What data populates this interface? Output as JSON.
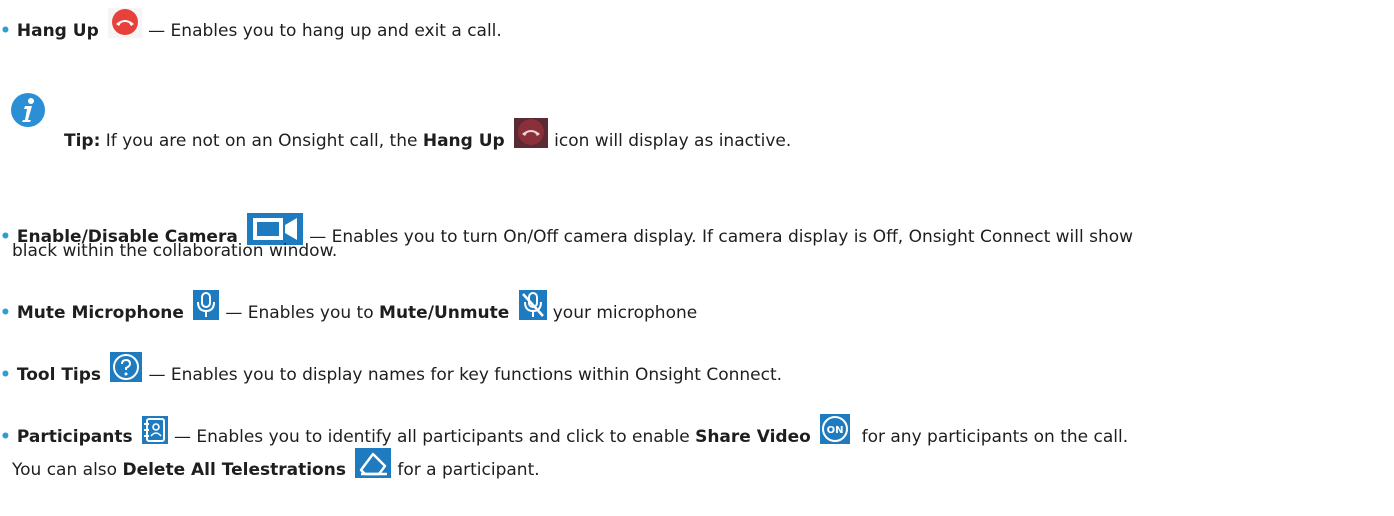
{
  "items": {
    "hangup": {
      "bullet": "•",
      "term": "Hang Up",
      "icon": "hang-up-icon",
      "desc": "— Enables you to hang up and exit a call."
    },
    "tip": {
      "icon": "info-icon",
      "label": "Tip:",
      "text1": "If you are not on an Onsight call, the",
      "term": "Hang Up",
      "text2": "icon will display as inactive."
    },
    "camera": {
      "bullet": "•",
      "term": "Enable/Disable Camera",
      "icon": "camera-icon",
      "desc": "— Enables you to turn On/Off camera display. If camera display is Off, Onsight Connect will show",
      "desc_cont": "black within the collaboration window."
    },
    "mute": {
      "bullet": "•",
      "term": "Mute Microphone",
      "icon": "microphone-icon",
      "desc1": "— Enables you to",
      "term2": "Mute",
      "slash": "/",
      "term3": "Unmute",
      "icon2": "microphone-muted-icon",
      "desc2": "your microphone"
    },
    "tooltips": {
      "bullet": "•",
      "term": "Tool Tips",
      "icon": "help-icon",
      "desc": "— Enables you to display names for key functions within Onsight Connect."
    },
    "participants": {
      "bullet": "•",
      "term": "Participants",
      "icon": "participants-icon",
      "desc1": "— Enables you to identify all participants and click to enable",
      "term2": "Share Video",
      "icon2": "share-video-on-icon",
      "desc2": "for any participants on the call.",
      "line2_text1": "You can also",
      "term3": "Delete All Telestrations",
      "icon3": "eraser-icon",
      "line2_text2": "for a participant."
    }
  },
  "colors": {
    "bullet": "#2a9fd6",
    "hangup_active": "#e8413b",
    "hangup_inactive": "#8b2f3a",
    "icon_blue": "#1f7bbf",
    "info_blue": "#2a8fd4"
  }
}
